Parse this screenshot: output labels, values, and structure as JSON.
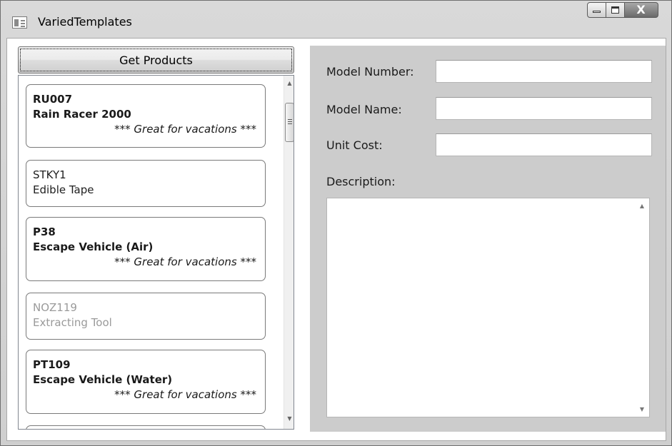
{
  "window": {
    "title": "VariedTemplates",
    "controls": {
      "minimize": "minimize",
      "maximize": "maximize",
      "close_glyph": "X"
    }
  },
  "left": {
    "get_products_label": "Get Products",
    "products": [
      {
        "code": "RU007",
        "name": "Rain Racer 2000",
        "tagline": "*** Great for vacations ***",
        "style": "bold"
      },
      {
        "code": "STKY1",
        "name": "Edible Tape",
        "tagline": "",
        "style": "plain"
      },
      {
        "code": "P38",
        "name": "Escape Vehicle (Air)",
        "tagline": "*** Great for vacations ***",
        "style": "bold"
      },
      {
        "code": "NOZ119",
        "name": "Extracting Tool",
        "tagline": "",
        "style": "dim"
      },
      {
        "code": "PT109",
        "name": "Escape Vehicle (Water)",
        "tagline": "*** Great for vacations ***",
        "style": "bold"
      },
      {
        "code": "",
        "name": "",
        "tagline": "",
        "style": "plain"
      }
    ],
    "scroll_position": 0.05
  },
  "details": {
    "model_number_label": "Model Number:",
    "model_number_value": "",
    "model_name_label": "Model Name:",
    "model_name_value": "",
    "unit_cost_label": "Unit Cost:",
    "unit_cost_value": "",
    "description_label": "Description:",
    "description_value": ""
  },
  "colors": {
    "panel_bg": "#cccccc",
    "card_border": "#7a7a7a",
    "dim_text": "#9a9a9a"
  }
}
